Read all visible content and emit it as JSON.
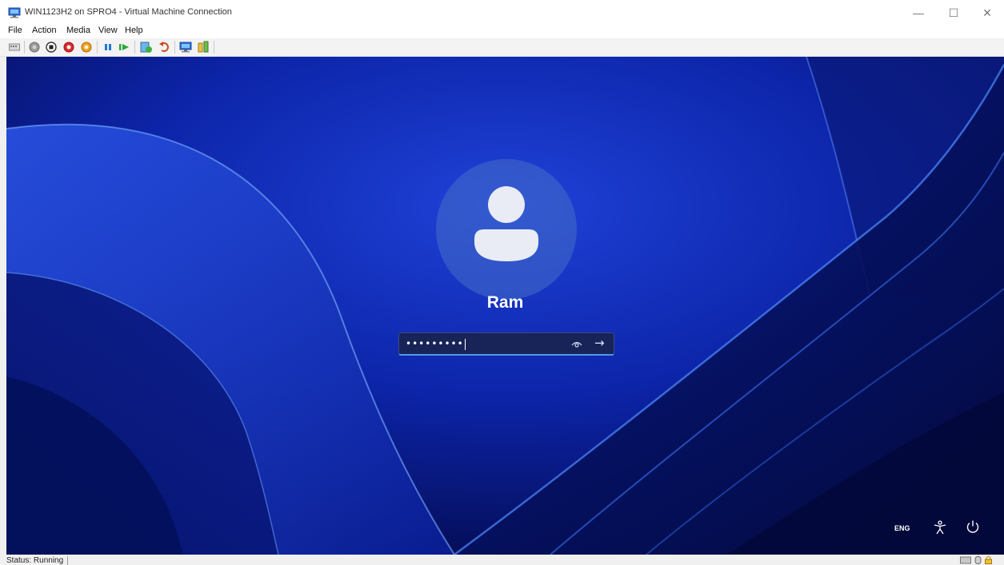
{
  "window": {
    "title": "WIN1123H2 on SPRO4 - Virtual Machine Connection",
    "controls": {
      "minimize": "—",
      "maximize": "☐",
      "close": "✕"
    }
  },
  "menu": [
    "File",
    "Action",
    "Media",
    "View",
    "Help"
  ],
  "toolbar": {
    "buttons": [
      "ctrl-alt-del-icon",
      "start-icon",
      "turn-off-icon",
      "shut-down-icon",
      "save-icon",
      "pause-icon",
      "resume-icon",
      "checkpoint-icon",
      "revert-icon",
      "enhanced-session-icon",
      "share-icon"
    ]
  },
  "login": {
    "username": "Ram",
    "password_masked": "•••••••••",
    "reveal_icon": "eye-icon",
    "submit_icon": "arrow-right-icon",
    "arrow_glyph": "→"
  },
  "corner": {
    "language": "ENG",
    "accessibility_icon": "accessibility-icon",
    "power_icon": "power-icon"
  },
  "status": {
    "text": "Status: Running"
  },
  "colors": {
    "wallpaper_base": "#0a1d8f",
    "accent": "#4c9dea",
    "avatar_circle": "#4a6ec8"
  }
}
